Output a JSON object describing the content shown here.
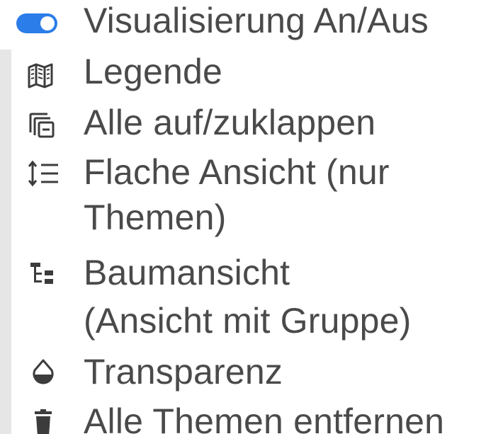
{
  "menu": {
    "items": [
      {
        "label": "Visualisierung An/Aus",
        "icon": "toggle-on-icon"
      },
      {
        "label": "Legende",
        "icon": "map-icon"
      },
      {
        "label": "Alle auf/zuklappen",
        "icon": "collapse-all-icon"
      },
      {
        "label": "Flache Ansicht (nur",
        "label_line2": "Themen)",
        "icon": "flat-list-icon"
      },
      {
        "label": "Baumansicht",
        "label_line2": "(Ansicht mit Gruppe)",
        "icon": "tree-view-icon"
      },
      {
        "label": "Transparenz",
        "icon": "opacity-icon"
      },
      {
        "label": "Alle Themen entfernen",
        "icon": "trash-icon"
      }
    ]
  },
  "colors": {
    "text": "#4a4a4a",
    "toggle_accent": "#2b7de9",
    "icon": "#3c3c3c"
  }
}
